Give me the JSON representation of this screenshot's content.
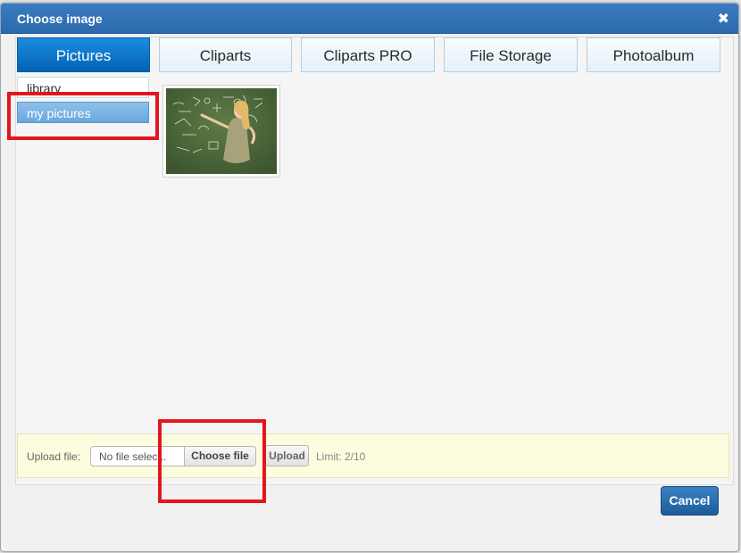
{
  "dialog": {
    "title": "Choose image",
    "close_glyph": "✖",
    "cancel_label": "Cancel"
  },
  "tabs": [
    {
      "label": "Pictures",
      "active": true
    },
    {
      "label": "Cliparts",
      "active": false
    },
    {
      "label": "Cliparts PRO",
      "active": false
    },
    {
      "label": "File Storage",
      "active": false
    },
    {
      "label": "Photoalbum",
      "active": false
    }
  ],
  "sidebar": {
    "items": [
      {
        "label": "library",
        "selected": false
      },
      {
        "label": "my pictures",
        "selected": true
      }
    ]
  },
  "gallery": {
    "images": [
      {
        "description": "girl-pointing-at-chalkboard-thumbnail"
      }
    ]
  },
  "upload": {
    "label": "Upload file:",
    "file_placeholder": "No file selec...",
    "choose_label": "Choose file",
    "upload_label": "Upload",
    "limit": "Limit: 2/10"
  },
  "colors": {
    "accent": "#0a6fc2",
    "highlight": "#e3151f",
    "titlebar": "#2f71b3"
  }
}
